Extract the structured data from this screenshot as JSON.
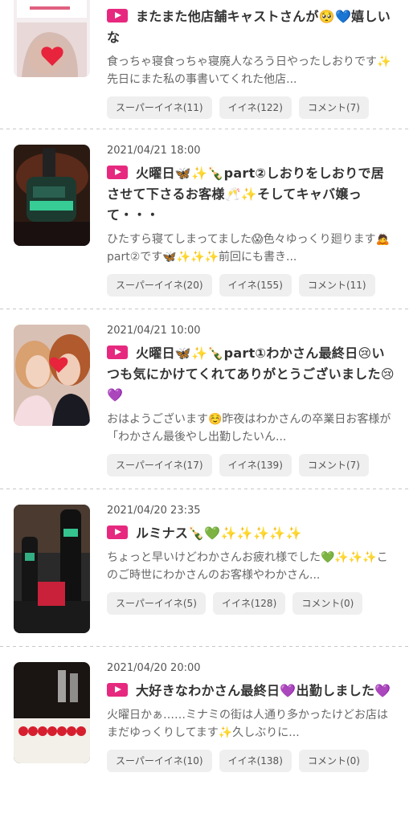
{
  "posts": [
    {
      "date": "",
      "title": "またまた他店舗キャストさんが🥺💙嬉しいな",
      "excerpt": "食っちゃ寝食っちゃ寝廃人なろう日やったしおりです✨先日にまた私の事書いてくれた他店...",
      "super_like": "スーパーイイネ(11)",
      "like": "イイネ(122)",
      "comment": "コメント(7)"
    },
    {
      "date": "2021/04/21 18:00",
      "title": "火曜日🦋✨🍾part②しおりをしおりで居させて下さるお客様🥂✨そしてキャバ嬢って・・・",
      "excerpt": "ひたすら寝てしまってました😱色々ゆっくり廻ります🙇part②です🦋✨✨✨前回にも書き...",
      "super_like": "スーパーイイネ(20)",
      "like": "イイネ(155)",
      "comment": "コメント(11)"
    },
    {
      "date": "2021/04/21 10:00",
      "title": "火曜日🦋✨🍾part①わかさん最終日😢いつも気にかけてくれてありがとうございました😢💜",
      "excerpt": " おはようございます☺️昨夜はわかさんの卒業日お客様が「わかさん最後やし出勤したいん...",
      "super_like": "スーパーイイネ(17)",
      "like": "イイネ(139)",
      "comment": "コメント(7)"
    },
    {
      "date": "2021/04/20 23:35",
      "title": "ルミナス🍾💚✨✨✨✨✨",
      "excerpt": "ちょっと早いけどわかさんお疲れ様でした💚✨✨✨このご時世にわかさんのお客様やわかさん...",
      "super_like": "スーパーイイネ(5)",
      "like": "イイネ(128)",
      "comment": "コメント(0)"
    },
    {
      "date": "2021/04/20 20:00",
      "title": "大好きなわかさん最終日💜出勤しました💜",
      "excerpt": "火曜日かぁ……ミナミの街は人通り多かったけどお店はまだゆっくりしてます✨久しぶりに...",
      "super_like": "スーパーイイネ(10)",
      "like": "イイネ(138)",
      "comment": "コメント(0)"
    }
  ]
}
